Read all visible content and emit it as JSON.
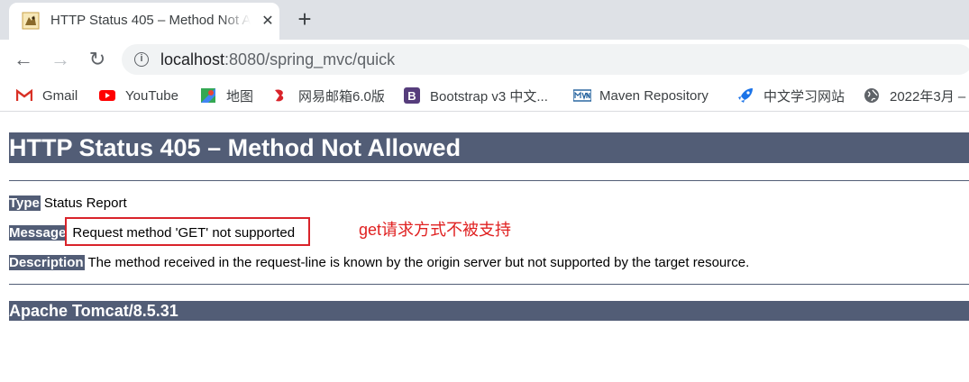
{
  "browser": {
    "tab": {
      "title": "HTTP Status 405 – Method Not Allowed",
      "close_glyph": "✕"
    },
    "new_tab_glyph": "+",
    "nav": {
      "back_glyph": "←",
      "forward_glyph": "→",
      "reload_glyph": "↻"
    },
    "address": {
      "host": "localhost",
      "rest": ":8080/spring_mvc/quick",
      "info_glyph": "i"
    },
    "bookmarks": [
      {
        "label": "Gmail",
        "icon": "gmail-icon"
      },
      {
        "label": "YouTube",
        "icon": "youtube-icon"
      },
      {
        "label": "地图",
        "icon": "maps-icon"
      },
      {
        "label": "网易邮箱6.0版",
        "icon": "netease-mail-icon"
      },
      {
        "label": "Bootstrap v3 中文...",
        "icon": "bootstrap-icon"
      },
      {
        "label": "Maven Repository",
        "icon": "maven-icon"
      },
      {
        "label": "中文学习网站",
        "icon": "rocket-icon"
      },
      {
        "label": "2022年3月 –",
        "icon": "globe-icon"
      }
    ]
  },
  "page": {
    "heading": "HTTP Status 405 – Method Not Allowed",
    "type_label": "Type",
    "type_value": "Status Report",
    "message_label": "Message",
    "message_value": "Request method 'GET' not supported",
    "description_label": "Description",
    "description_value": "The method received in the request-line is known by the origin server but not supported by the target resource.",
    "footer": "Apache Tomcat/8.5.31",
    "annotation": "get请求方式不被支持"
  },
  "colors": {
    "header_bg": "#525d76",
    "annotation": "#e02020",
    "highlight_border": "#d9232a"
  }
}
